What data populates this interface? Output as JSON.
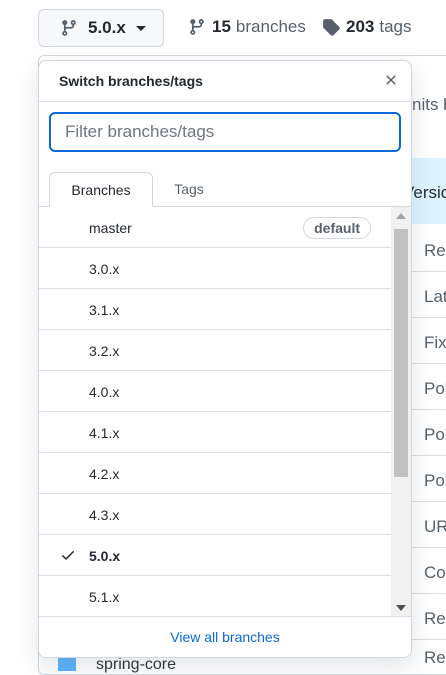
{
  "toolbar": {
    "current_branch": "5.0.x",
    "branches_count": "15",
    "branches_label": "branches",
    "tags_count": "203",
    "tags_label": "tags"
  },
  "background": {
    "header_fragment": "nits b",
    "column_fragment": "Versio",
    "row_fragments": [
      "Rer",
      "Lat",
      "Fix",
      "Pol",
      "Pol",
      "Pol",
      "UR",
      "Co",
      "Rer",
      "Re"
    ],
    "bottom_item": "spring-core",
    "accent": "#ddf4ff"
  },
  "dropdown": {
    "title": "Switch branches/tags",
    "filter_placeholder": "Filter branches/tags",
    "tabs": [
      "Branches",
      "Tags"
    ],
    "items": [
      {
        "name": "master",
        "badge": "default"
      },
      {
        "name": "3.0.x"
      },
      {
        "name": "3.1.x"
      },
      {
        "name": "3.2.x"
      },
      {
        "name": "4.0.x"
      },
      {
        "name": "4.1.x"
      },
      {
        "name": "4.2.x"
      },
      {
        "name": "4.3.x"
      },
      {
        "name": "5.0.x",
        "selected": true
      },
      {
        "name": "5.1.x"
      }
    ],
    "footer_link": "View all branches"
  },
  "colors": {
    "link": "#0969da",
    "focus": "#0969da",
    "border": "#d0d7de"
  },
  "icons": [
    "git-branch-icon",
    "chevron-down-icon",
    "tag-icon",
    "close-icon",
    "check-icon"
  ]
}
